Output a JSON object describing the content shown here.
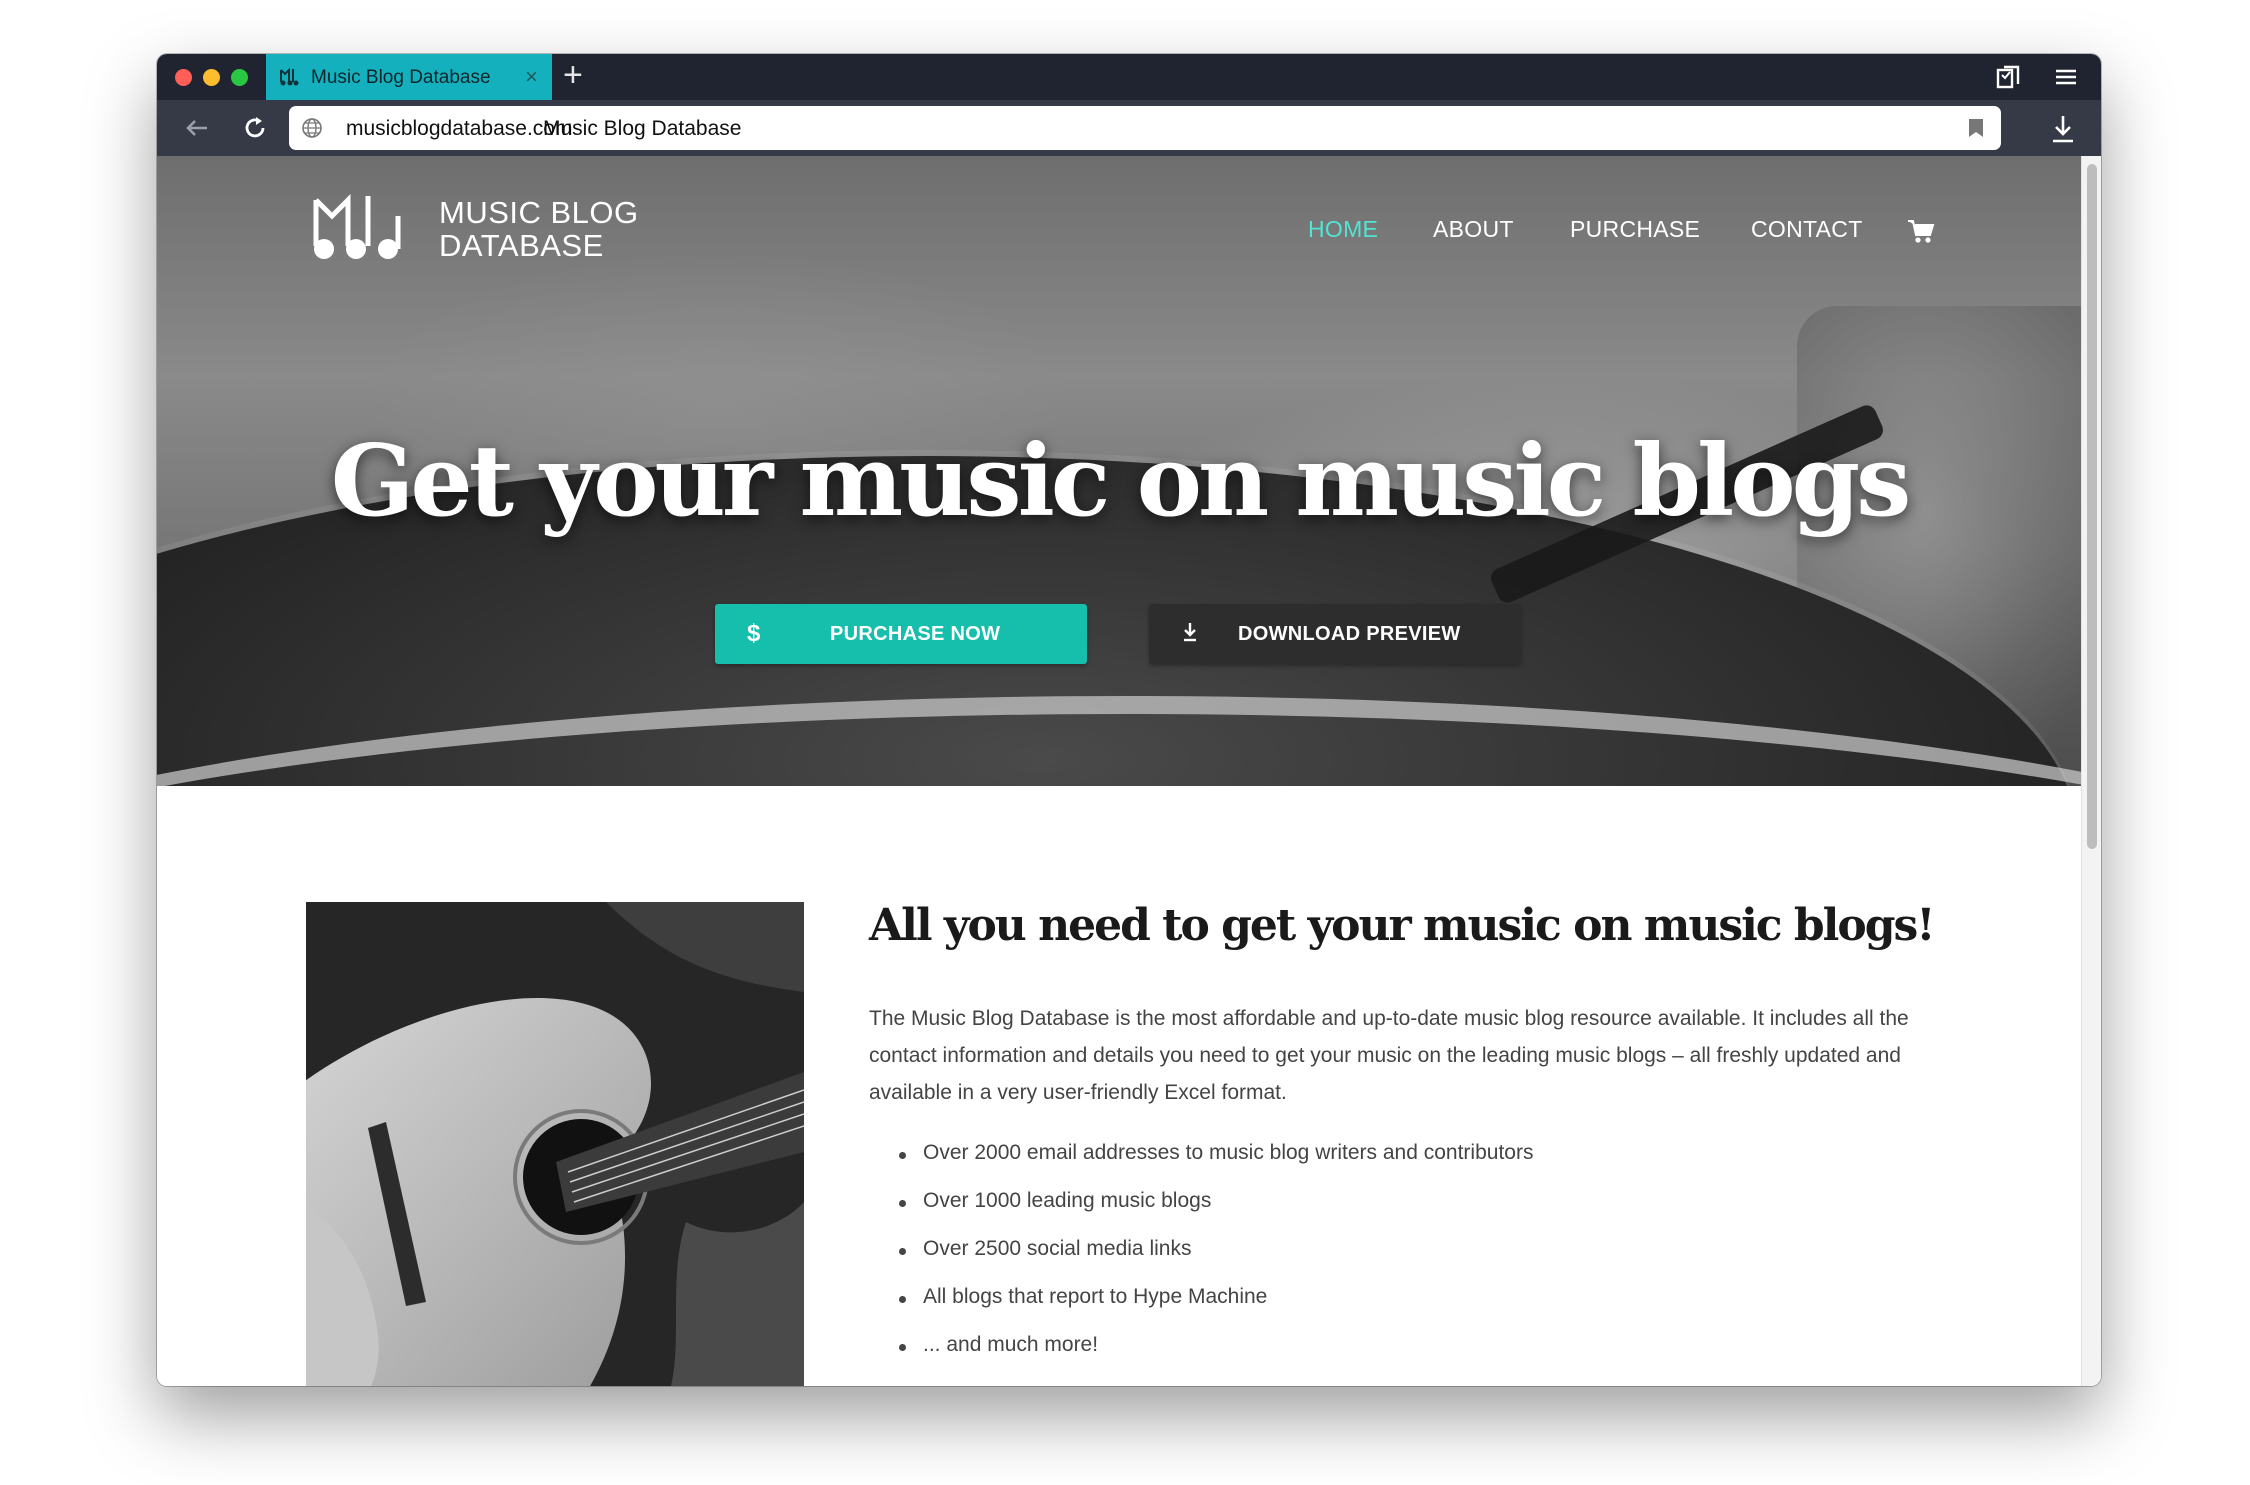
{
  "browser": {
    "tab_title": "Music Blog Database",
    "tab_close": "×",
    "new_tab": "+",
    "url_host": "musicblogdatabase.com",
    "url_title": "Music Blog Database"
  },
  "site": {
    "logo_line1": "MUSIC BLOG",
    "logo_line2": "DATABASE",
    "nav": {
      "home": "HOME",
      "about": "ABOUT",
      "purchase": "PURCHASE",
      "contact": "CONTACT"
    },
    "hero": {
      "headline": "Get your music on music blogs",
      "purchase_button": "PURCHASE NOW",
      "purchase_icon": "$",
      "download_button": "DOWNLOAD PREVIEW"
    },
    "section": {
      "title": "All you need to get your music on music blogs!",
      "intro": "The Music Blog Database is the most affordable and up-to-date music blog resource available. It includes all the contact information and details you need to get your music on the leading music blogs – all freshly updated and available in a very user-friendly Excel format.",
      "features": [
        "Over 2000 email addresses to music blog writers and contributors",
        "Over 1000 leading music blogs",
        "Over 2500 social media links",
        "All blogs that report to Hype Machine",
        "... and much more!"
      ]
    },
    "colors": {
      "accent": "#15bfab",
      "nav_active": "#52e4d2",
      "tab": "#15b0bd",
      "dark_button": "#2d2d2d"
    },
    "icons": [
      "globe-icon",
      "back-icon",
      "reload-icon",
      "bookmark-icon",
      "download-icon",
      "menu-icon",
      "bookmarks-panel-icon",
      "cart-icon",
      "dollar-icon"
    ]
  }
}
